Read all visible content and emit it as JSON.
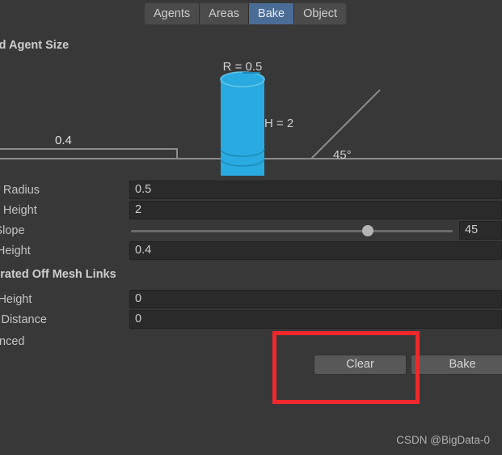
{
  "window": {
    "background_color": "#383838",
    "accent_color": "#4a6d96",
    "highlight_color": "#f0282d"
  },
  "tabs": [
    {
      "label": "Agents",
      "active": false
    },
    {
      "label": "Areas",
      "active": false
    },
    {
      "label": "Bake",
      "active": true
    },
    {
      "label": "Object",
      "active": false
    }
  ],
  "sections": {
    "baked_agent_size": {
      "header": "Baked Agent Size",
      "diagram": {
        "radius_label": "R = 0.5",
        "height_label": "H = 2",
        "slope_label": "45°",
        "step_label": "0.4",
        "cylinder_color": "#29abe2",
        "line_color": "#8c8c8c"
      },
      "rows": [
        {
          "label": "Agent Radius",
          "value": "0.5",
          "type": "number"
        },
        {
          "label": "Agent Height",
          "value": "2",
          "type": "number"
        },
        {
          "label": "Max Slope",
          "value": "45",
          "type": "slider",
          "min": 0,
          "max": 60
        },
        {
          "label": "Step Height",
          "value": "0.4",
          "type": "number"
        }
      ]
    },
    "generated_off_mesh_links": {
      "header": "Generated Off Mesh Links",
      "rows": [
        {
          "label": "Drop Height",
          "value": "0",
          "type": "number"
        },
        {
          "label": "Jump Distance",
          "value": "0",
          "type": "number"
        }
      ]
    },
    "advanced": {
      "label": "Advanced"
    }
  },
  "buttons": {
    "clear": "Clear",
    "bake": "Bake"
  },
  "watermark": "CSDN @BigData-0"
}
